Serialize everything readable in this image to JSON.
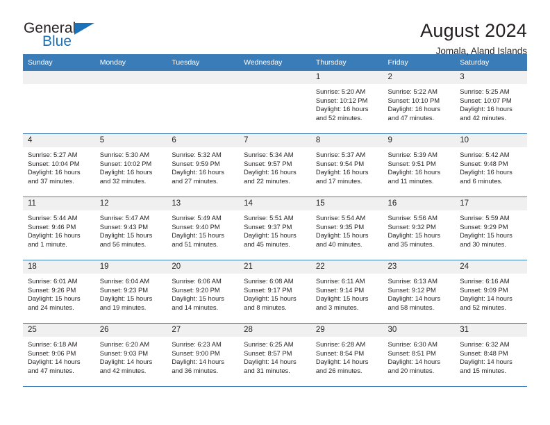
{
  "brand": {
    "word_one": "General",
    "word_two": "Blue",
    "triangle_color": "#1b72b8"
  },
  "header": {
    "title": "August 2024",
    "subtitle": "Jomala, Aland Islands",
    "header_bg": "#3a7cb8",
    "daynum_bg": "#f0f0f0"
  },
  "weekday_headers": [
    "Sunday",
    "Monday",
    "Tuesday",
    "Wednesday",
    "Thursday",
    "Friday",
    "Saturday"
  ],
  "labels": {
    "sunrise": "Sunrise:",
    "sunset": "Sunset:",
    "daylight": "Daylight:"
  },
  "weeks": [
    [
      {
        "day": "",
        "l1": "",
        "l2": "",
        "l3": "",
        "l4": ""
      },
      {
        "day": "",
        "l1": "",
        "l2": "",
        "l3": "",
        "l4": ""
      },
      {
        "day": "",
        "l1": "",
        "l2": "",
        "l3": "",
        "l4": ""
      },
      {
        "day": "",
        "l1": "",
        "l2": "",
        "l3": "",
        "l4": ""
      },
      {
        "day": "1",
        "l1": "Sunrise: 5:20 AM",
        "l2": "Sunset: 10:12 PM",
        "l3": "Daylight: 16 hours",
        "l4": "and 52 minutes."
      },
      {
        "day": "2",
        "l1": "Sunrise: 5:22 AM",
        "l2": "Sunset: 10:10 PM",
        "l3": "Daylight: 16 hours",
        "l4": "and 47 minutes."
      },
      {
        "day": "3",
        "l1": "Sunrise: 5:25 AM",
        "l2": "Sunset: 10:07 PM",
        "l3": "Daylight: 16 hours",
        "l4": "and 42 minutes."
      }
    ],
    [
      {
        "day": "4",
        "l1": "Sunrise: 5:27 AM",
        "l2": "Sunset: 10:04 PM",
        "l3": "Daylight: 16 hours",
        "l4": "and 37 minutes."
      },
      {
        "day": "5",
        "l1": "Sunrise: 5:30 AM",
        "l2": "Sunset: 10:02 PM",
        "l3": "Daylight: 16 hours",
        "l4": "and 32 minutes."
      },
      {
        "day": "6",
        "l1": "Sunrise: 5:32 AM",
        "l2": "Sunset: 9:59 PM",
        "l3": "Daylight: 16 hours",
        "l4": "and 27 minutes."
      },
      {
        "day": "7",
        "l1": "Sunrise: 5:34 AM",
        "l2": "Sunset: 9:57 PM",
        "l3": "Daylight: 16 hours",
        "l4": "and 22 minutes."
      },
      {
        "day": "8",
        "l1": "Sunrise: 5:37 AM",
        "l2": "Sunset: 9:54 PM",
        "l3": "Daylight: 16 hours",
        "l4": "and 17 minutes."
      },
      {
        "day": "9",
        "l1": "Sunrise: 5:39 AM",
        "l2": "Sunset: 9:51 PM",
        "l3": "Daylight: 16 hours",
        "l4": "and 11 minutes."
      },
      {
        "day": "10",
        "l1": "Sunrise: 5:42 AM",
        "l2": "Sunset: 9:48 PM",
        "l3": "Daylight: 16 hours",
        "l4": "and 6 minutes."
      }
    ],
    [
      {
        "day": "11",
        "l1": "Sunrise: 5:44 AM",
        "l2": "Sunset: 9:46 PM",
        "l3": "Daylight: 16 hours",
        "l4": "and 1 minute."
      },
      {
        "day": "12",
        "l1": "Sunrise: 5:47 AM",
        "l2": "Sunset: 9:43 PM",
        "l3": "Daylight: 15 hours",
        "l4": "and 56 minutes."
      },
      {
        "day": "13",
        "l1": "Sunrise: 5:49 AM",
        "l2": "Sunset: 9:40 PM",
        "l3": "Daylight: 15 hours",
        "l4": "and 51 minutes."
      },
      {
        "day": "14",
        "l1": "Sunrise: 5:51 AM",
        "l2": "Sunset: 9:37 PM",
        "l3": "Daylight: 15 hours",
        "l4": "and 45 minutes."
      },
      {
        "day": "15",
        "l1": "Sunrise: 5:54 AM",
        "l2": "Sunset: 9:35 PM",
        "l3": "Daylight: 15 hours",
        "l4": "and 40 minutes."
      },
      {
        "day": "16",
        "l1": "Sunrise: 5:56 AM",
        "l2": "Sunset: 9:32 PM",
        "l3": "Daylight: 15 hours",
        "l4": "and 35 minutes."
      },
      {
        "day": "17",
        "l1": "Sunrise: 5:59 AM",
        "l2": "Sunset: 9:29 PM",
        "l3": "Daylight: 15 hours",
        "l4": "and 30 minutes."
      }
    ],
    [
      {
        "day": "18",
        "l1": "Sunrise: 6:01 AM",
        "l2": "Sunset: 9:26 PM",
        "l3": "Daylight: 15 hours",
        "l4": "and 24 minutes."
      },
      {
        "day": "19",
        "l1": "Sunrise: 6:04 AM",
        "l2": "Sunset: 9:23 PM",
        "l3": "Daylight: 15 hours",
        "l4": "and 19 minutes."
      },
      {
        "day": "20",
        "l1": "Sunrise: 6:06 AM",
        "l2": "Sunset: 9:20 PM",
        "l3": "Daylight: 15 hours",
        "l4": "and 14 minutes."
      },
      {
        "day": "21",
        "l1": "Sunrise: 6:08 AM",
        "l2": "Sunset: 9:17 PM",
        "l3": "Daylight: 15 hours",
        "l4": "and 8 minutes."
      },
      {
        "day": "22",
        "l1": "Sunrise: 6:11 AM",
        "l2": "Sunset: 9:14 PM",
        "l3": "Daylight: 15 hours",
        "l4": "and 3 minutes."
      },
      {
        "day": "23",
        "l1": "Sunrise: 6:13 AM",
        "l2": "Sunset: 9:12 PM",
        "l3": "Daylight: 14 hours",
        "l4": "and 58 minutes."
      },
      {
        "day": "24",
        "l1": "Sunrise: 6:16 AM",
        "l2": "Sunset: 9:09 PM",
        "l3": "Daylight: 14 hours",
        "l4": "and 52 minutes."
      }
    ],
    [
      {
        "day": "25",
        "l1": "Sunrise: 6:18 AM",
        "l2": "Sunset: 9:06 PM",
        "l3": "Daylight: 14 hours",
        "l4": "and 47 minutes."
      },
      {
        "day": "26",
        "l1": "Sunrise: 6:20 AM",
        "l2": "Sunset: 9:03 PM",
        "l3": "Daylight: 14 hours",
        "l4": "and 42 minutes."
      },
      {
        "day": "27",
        "l1": "Sunrise: 6:23 AM",
        "l2": "Sunset: 9:00 PM",
        "l3": "Daylight: 14 hours",
        "l4": "and 36 minutes."
      },
      {
        "day": "28",
        "l1": "Sunrise: 6:25 AM",
        "l2": "Sunset: 8:57 PM",
        "l3": "Daylight: 14 hours",
        "l4": "and 31 minutes."
      },
      {
        "day": "29",
        "l1": "Sunrise: 6:28 AM",
        "l2": "Sunset: 8:54 PM",
        "l3": "Daylight: 14 hours",
        "l4": "and 26 minutes."
      },
      {
        "day": "30",
        "l1": "Sunrise: 6:30 AM",
        "l2": "Sunset: 8:51 PM",
        "l3": "Daylight: 14 hours",
        "l4": "and 20 minutes."
      },
      {
        "day": "31",
        "l1": "Sunrise: 6:32 AM",
        "l2": "Sunset: 8:48 PM",
        "l3": "Daylight: 14 hours",
        "l4": "and 15 minutes."
      }
    ]
  ]
}
